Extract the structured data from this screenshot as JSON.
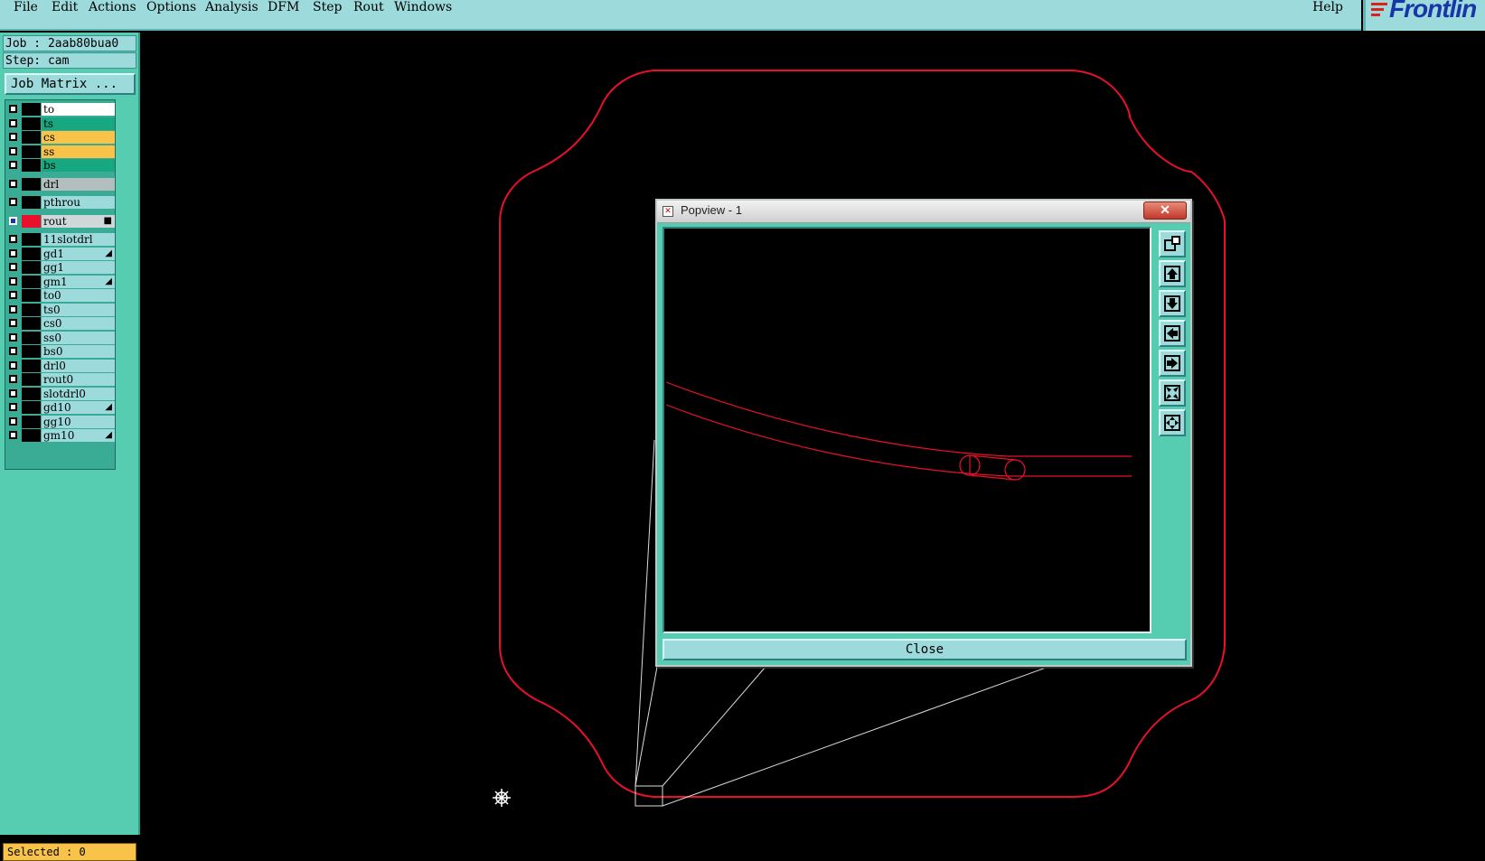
{
  "menubar": {
    "items": [
      "File",
      "Edit",
      "Actions",
      "Options",
      "Analysis",
      "DFM",
      "Step",
      "Rout",
      "Windows"
    ],
    "help": "Help"
  },
  "brand": {
    "logo_text": "Frontlin"
  },
  "info": {
    "job": "Job : 2aab80bua0",
    "step": "Step: cam"
  },
  "job_matrix_button": "Job Matrix ...",
  "layers": [
    {
      "name": "to",
      "bg": "#ffffff"
    },
    {
      "name": "ts",
      "bg": "#17a882"
    },
    {
      "name": "cs",
      "bg": "#f9c349"
    },
    {
      "name": "ss",
      "bg": "#f9c349"
    },
    {
      "name": "bs",
      "bg": "#17a882"
    },
    {
      "name": "drl",
      "bg": "#b4bebe"
    },
    {
      "name": "pthrou",
      "bg": "#9cdadc"
    },
    {
      "name": "rout",
      "bg": "#cfd8d8",
      "flag": "■",
      "active": true,
      "color": "#e8102a"
    },
    {
      "name": "11slotdrl",
      "bg": "#9cdadc"
    },
    {
      "name": "gd1",
      "bg": "#9cdadc",
      "flag": "◢"
    },
    {
      "name": "gg1",
      "bg": "#9cdadc"
    },
    {
      "name": "gm1",
      "bg": "#9cdadc",
      "flag": "◢"
    },
    {
      "name": "to0",
      "bg": "#9cdadc"
    },
    {
      "name": "ts0",
      "bg": "#9cdadc"
    },
    {
      "name": "cs0",
      "bg": "#9cdadc"
    },
    {
      "name": "ss0",
      "bg": "#9cdadc"
    },
    {
      "name": "bs0",
      "bg": "#9cdadc"
    },
    {
      "name": "drl0",
      "bg": "#9cdadc"
    },
    {
      "name": "rout0",
      "bg": "#9cdadc"
    },
    {
      "name": "slotdrl0",
      "bg": "#9cdadc"
    },
    {
      "name": "gd10",
      "bg": "#9cdadc",
      "flag": "◢"
    },
    {
      "name": "gg10",
      "bg": "#9cdadc"
    },
    {
      "name": "gm10",
      "bg": "#9cdadc",
      "flag": "◢"
    }
  ],
  "selected": "Selected : 0",
  "popview": {
    "title": "Popview - 1",
    "close_label": "Close",
    "close_x": "✕",
    "tools": [
      "zoom-window-icon",
      "pan-up-icon",
      "pan-down-icon",
      "pan-left-icon",
      "pan-right-icon",
      "zoom-fit-icon",
      "zoom-home-icon"
    ]
  },
  "colors": {
    "outline": "#e8102a",
    "panel": "#56cdb1",
    "menubar": "#9cdadc"
  }
}
